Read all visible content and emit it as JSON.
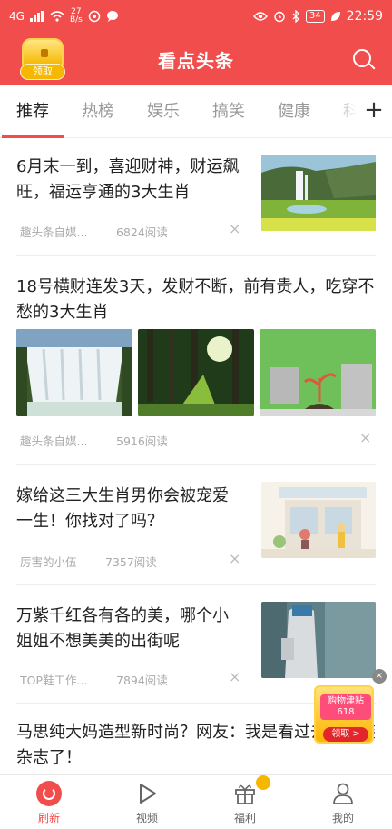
{
  "status_bar": {
    "network": "4G",
    "speed": "27\nB/s",
    "battery": "34",
    "time": "22:59"
  },
  "header": {
    "title": "看点头条",
    "reward_label": "领取"
  },
  "tabs": [
    {
      "label": "推荐",
      "active": true
    },
    {
      "label": "热榜",
      "active": false
    },
    {
      "label": "娱乐",
      "active": false
    },
    {
      "label": "搞笑",
      "active": false
    },
    {
      "label": "健康",
      "active": false
    },
    {
      "label": "科",
      "active": false
    }
  ],
  "add_tab_icon": "+",
  "articles": [
    {
      "title": "6月末一到，喜迎财神，财运飙旺，福运亨通的3大生肖",
      "source": "趣头条自媒...",
      "reads": "6824阅读",
      "layout": "right-thumb",
      "image": "waterfall-cliff"
    },
    {
      "title": "18号横财连发3天，发财不断，前有贵人，吃穿不愁的3大生肖",
      "source": "趣头条自媒...",
      "reads": "5916阅读",
      "layout": "three-thumbs",
      "images": [
        "waterfall",
        "forest",
        "coins-plant"
      ]
    },
    {
      "title": "嫁给这三大生肖男你会被宠爱一生！你找对了吗？",
      "source": "厉害的小伍",
      "reads": "7357阅读",
      "layout": "right-thumb",
      "image": "illustration-shop"
    },
    {
      "title": "万紫千红各有各的美，哪个小姐姐不想美美的出街呢",
      "source": "TOP鞋工作...",
      "reads": "7894阅读",
      "layout": "right-thumb",
      "image": "fashion-photo"
    },
    {
      "title": "马思纯大妈造型新时尚？网友：我是看过去的时装杂志了！",
      "source": "",
      "reads": "",
      "layout": "text-only"
    }
  ],
  "close_glyph": "×",
  "promo": {
    "top_text": "购物津贴\n618",
    "button": "领取 >"
  },
  "bottom_nav": [
    {
      "label": "刷新",
      "icon": "refresh-icon",
      "active": true
    },
    {
      "label": "视频",
      "icon": "play-icon",
      "active": false
    },
    {
      "label": "福利",
      "icon": "gift-icon",
      "active": false
    },
    {
      "label": "我的",
      "icon": "user-icon",
      "active": false
    }
  ],
  "colors": {
    "brand_red": "#f24d4d",
    "gold": "#f5b700"
  }
}
